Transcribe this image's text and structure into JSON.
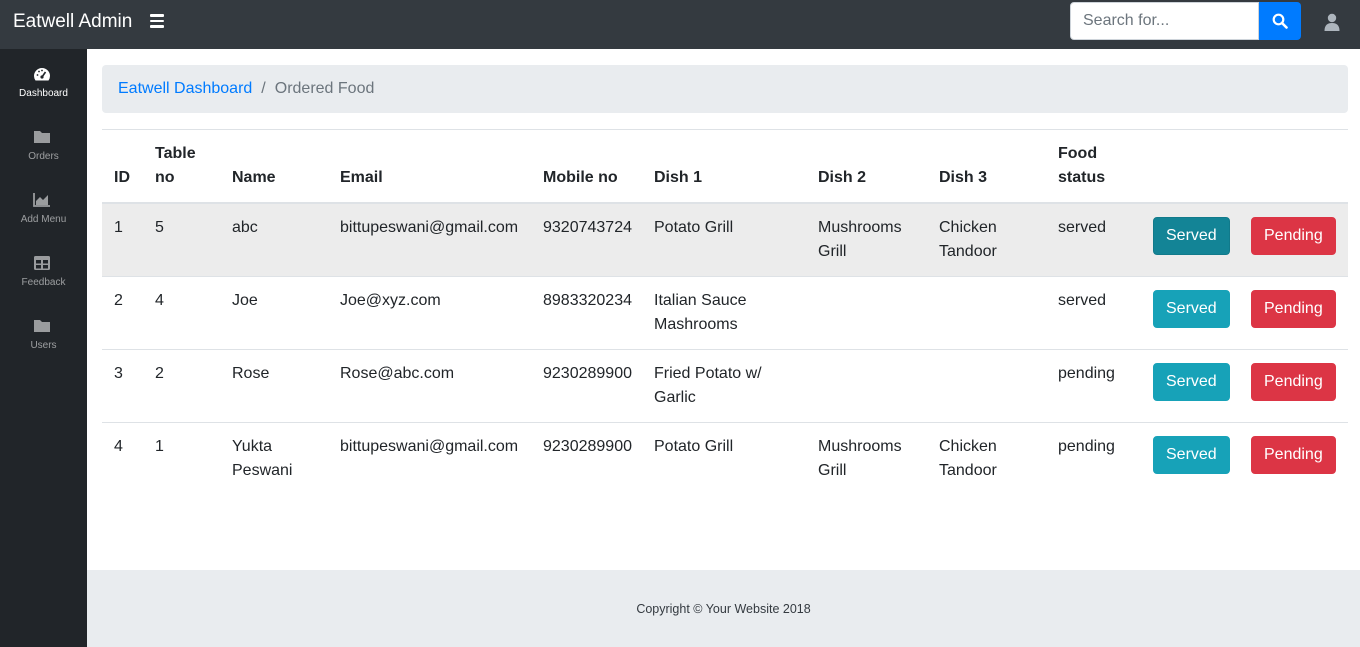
{
  "header": {
    "brand": "Eatwell Admin",
    "search_placeholder": "Search for..."
  },
  "sidebar": {
    "items": [
      {
        "label": "Dashboard",
        "icon": "tachometer-icon"
      },
      {
        "label": "Orders",
        "icon": "folder-icon"
      },
      {
        "label": "Add Menu",
        "icon": "area-chart-icon"
      },
      {
        "label": "Feedback",
        "icon": "table-icon"
      },
      {
        "label": "Users",
        "icon": "folder-icon"
      }
    ]
  },
  "breadcrumb": {
    "link": "Eatwell Dashboard",
    "separator": "/",
    "active": "Ordered Food"
  },
  "table": {
    "headers": [
      "ID",
      "Table no",
      "Name",
      "Email",
      "Mobile no",
      "Dish 1",
      "Dish 2",
      "Dish 3",
      "Food status",
      "",
      ""
    ],
    "rows": [
      {
        "id": "1",
        "table_no": "5",
        "name": "abc",
        "email": "bittupeswani@gmail.com",
        "mobile": "9320743724",
        "dish1": "Potato Grill",
        "dish2": "Mushrooms Grill",
        "dish3": "Chicken Tandoor",
        "status": "served",
        "served_label": "Served",
        "pending_label": "Pending"
      },
      {
        "id": "2",
        "table_no": "4",
        "name": "Joe",
        "email": "Joe@xyz.com",
        "mobile": "8983320234",
        "dish1": "Italian Sauce Mashrooms",
        "dish2": "",
        "dish3": "",
        "status": "served",
        "served_label": "Served",
        "pending_label": "Pending"
      },
      {
        "id": "3",
        "table_no": "2",
        "name": "Rose",
        "email": "Rose@abc.com",
        "mobile": "9230289900",
        "dish1": "Fried Potato w/ Garlic",
        "dish2": "",
        "dish3": "",
        "status": "pending",
        "served_label": "Served",
        "pending_label": "Pending"
      },
      {
        "id": "4",
        "table_no": "1",
        "name": "Yukta Peswani",
        "email": "bittupeswani@gmail.com",
        "mobile": "9230289900",
        "dish1": "Potato Grill",
        "dish2": "Mushrooms Grill",
        "dish3": "Chicken Tandoor",
        "status": "pending",
        "served_label": "Served",
        "pending_label": "Pending"
      }
    ]
  },
  "footer": {
    "copyright": "Copyright © Your Website 2018"
  },
  "colors": {
    "topbar": "#343a40",
    "sidebar": "#212529",
    "primary": "#007bff",
    "info": "#17a2b8",
    "danger": "#dc3545"
  }
}
